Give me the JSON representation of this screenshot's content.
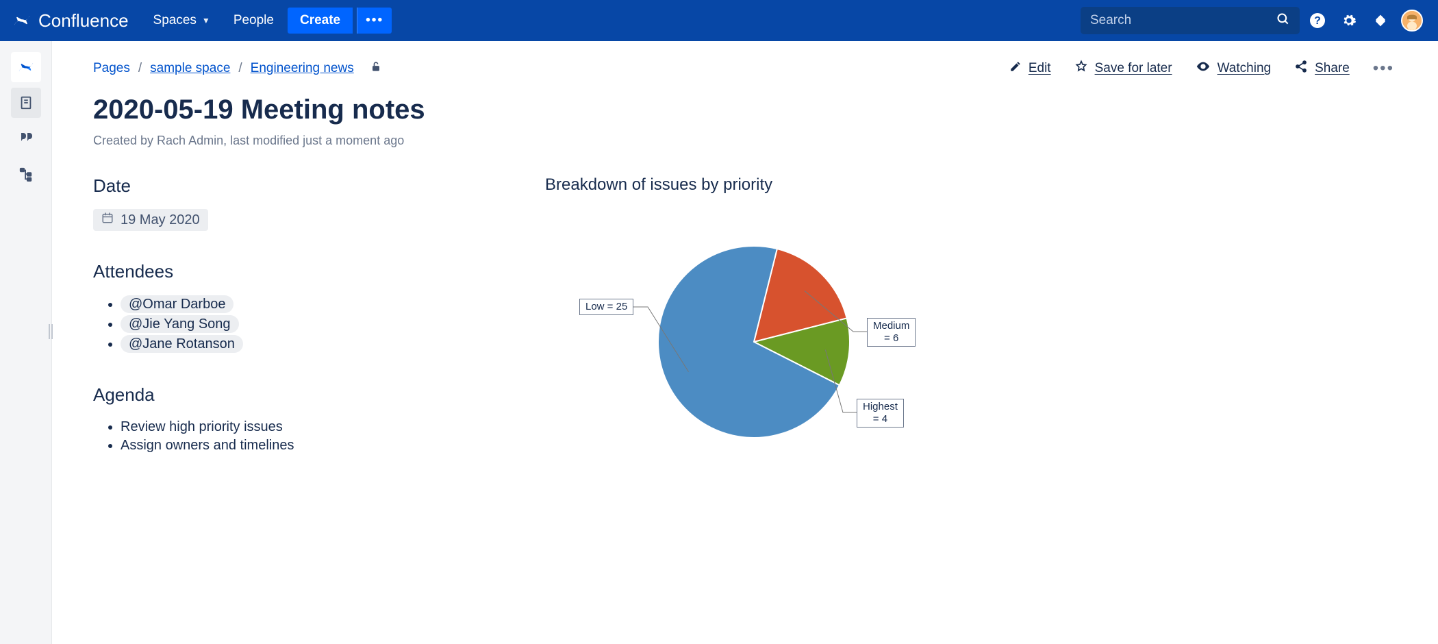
{
  "nav": {
    "brand": "Confluence",
    "spaces": "Spaces",
    "people": "People",
    "create": "Create",
    "create_more": "•••",
    "search_placeholder": "Search"
  },
  "breadcrumbs": {
    "pages": "Pages",
    "space": "sample space",
    "section": "Engineering news"
  },
  "actions": {
    "edit": "Edit",
    "save": "Save for later",
    "watching": "Watching",
    "share": "Share",
    "more": "•••"
  },
  "page": {
    "title": "2020-05-19 Meeting notes",
    "byline": "Created by Rach Admin, last modified just a moment ago"
  },
  "sections": {
    "date_heading": "Date",
    "date_value": "19 May 2020",
    "attendees_heading": "Attendees",
    "attendees": [
      "@Omar Darboe",
      "@Jie Yang Song",
      "@Jane Rotanson"
    ],
    "agenda_heading": "Agenda",
    "agenda_items": [
      "Review high priority issues",
      "Assign owners and timelines"
    ]
  },
  "chart_title": "Breakdown of issues by priority",
  "chart_data": {
    "type": "pie",
    "title": "Breakdown of issues by priority",
    "series": [
      {
        "name": "Low",
        "value": 25,
        "label": "Low = 25",
        "color": "#4c8cc3"
      },
      {
        "name": "Medium",
        "value": 6,
        "label": "Medium = 6",
        "color": "#d7522e"
      },
      {
        "name": "Highest",
        "value": 4,
        "label": "Highest = 4",
        "color": "#6a9a23"
      }
    ]
  }
}
